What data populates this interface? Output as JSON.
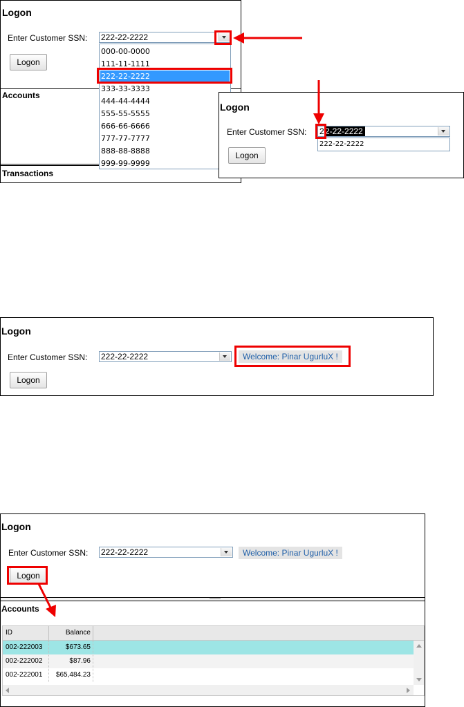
{
  "logon_title": "Logon",
  "ssn_label": "Enter Customer SSN:",
  "selected_ssn": "222-22-2222",
  "logon_button": "Logon",
  "accounts_title": "Accounts",
  "transactions_title": "Transactions",
  "ssn_options": [
    "000-00-0000",
    "111-11-1111",
    "222-22-2222",
    "333-33-3333",
    "444-44-4444",
    "555-55-5555",
    "666-66-6666",
    "777-77-7777",
    "888-88-8888",
    "999-99-9999"
  ],
  "inset": {
    "typed_char": "2",
    "typed_rest": "2-22-2222",
    "suggestion": "222-22-2222"
  },
  "welcome_message": "Welcome: Pinar UgurluX !",
  "accounts_table": {
    "columns": [
      "ID",
      "Balance"
    ],
    "rows": [
      {
        "id": "002-222003",
        "balance": "$673.65"
      },
      {
        "id": "002-222002",
        "balance": "$87.96"
      },
      {
        "id": "002-222001",
        "balance": "$65,484.23"
      }
    ]
  },
  "colors": {
    "annotation_red": "#e00000",
    "selection_blue": "#3399ff",
    "row_highlight": "#9de5e5",
    "welcome_text": "#1f5fa8"
  }
}
